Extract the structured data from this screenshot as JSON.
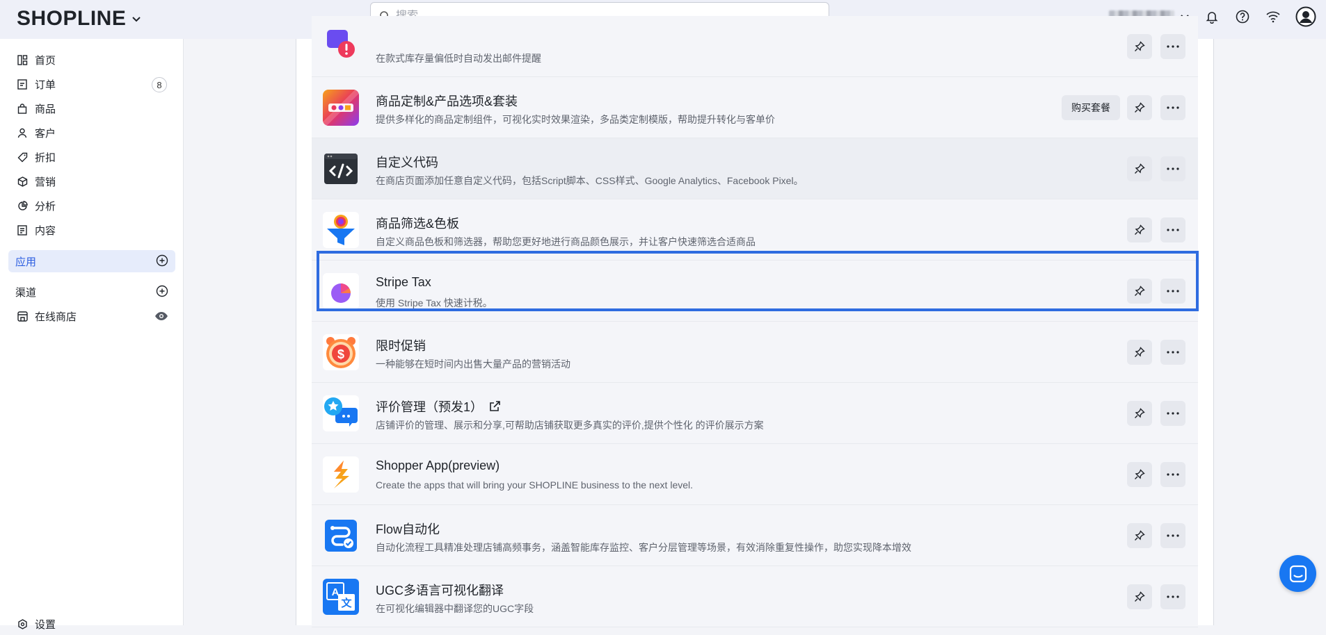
{
  "brand": {
    "logo_text": "SHOPLINE",
    "accent": "#2f6ce0"
  },
  "search": {
    "placeholder": "搜索"
  },
  "sidebar": {
    "items": [
      {
        "label": "首页",
        "icon": "home-icon"
      },
      {
        "label": "订单",
        "icon": "order-icon",
        "badge": "8"
      },
      {
        "label": "商品",
        "icon": "bag-icon"
      },
      {
        "label": "客户",
        "icon": "user-icon"
      },
      {
        "label": "折扣",
        "icon": "tag-icon"
      },
      {
        "label": "营销",
        "icon": "cube-icon"
      },
      {
        "label": "分析",
        "icon": "pie-icon"
      },
      {
        "label": "内容",
        "icon": "doc-icon"
      }
    ],
    "apps_label": "应用",
    "channels_label": "渠道",
    "online_store_label": "在线商店",
    "settings_label": "设置"
  },
  "apps": [
    {
      "title": "",
      "desc": "在款式库存量偏低时自动发出邮件提醒",
      "icon": "low-stock-alert-icon"
    },
    {
      "title": "商品定制&产品选项&套装",
      "desc": "提供多样化的商品定制组件，可视化实时效果渲染，多品类定制模版，帮助提升转化与客单价",
      "buy": "购买套餐",
      "icon": "product-customizer-icon"
    },
    {
      "title": "自定义代码",
      "desc": "在商店页面添加任意自定义代码，包括Script脚本、CSS样式、Google Analytics、Facebook Pixel。",
      "icon": "code-icon"
    },
    {
      "title": "商品筛选&色板",
      "desc": "自定义商品色板和筛选器，帮助您更好地进行商品颜色展示，并让客户快速筛选合适商品",
      "icon": "filter-funnel-icon"
    },
    {
      "title": "Stripe Tax",
      "desc": "使用 Stripe Tax 快速计税。",
      "icon": "stripe-tax-icon"
    },
    {
      "title": "限时促销",
      "desc": "一种能够在短时间内出售大量产品的营销活动",
      "icon": "flash-sale-clock-icon"
    },
    {
      "title": "评价管理（预发1）",
      "desc": "店铺评价的管理、展示和分享,可帮助店铺获取更多真实的评价,提供个性化 的评价展示方案",
      "external": true,
      "icon": "review-chat-icon"
    },
    {
      "title": "Shopper App(preview)",
      "desc": "Create the apps that will bring your SHOPLINE business to the next level.",
      "icon": "shopper-app-icon"
    },
    {
      "title": "Flow自动化",
      "desc": "自动化流程工具精准处理店铺高频事务，涵盖智能库存监控、客户分层管理等场景，有效消除重复性操作，助您实现降本增效",
      "icon": "flow-icon"
    },
    {
      "title": "UGC多语言可视化翻译",
      "desc": "在可视化编辑器中翻译您的UGC字段",
      "icon": "translate-icon"
    }
  ]
}
